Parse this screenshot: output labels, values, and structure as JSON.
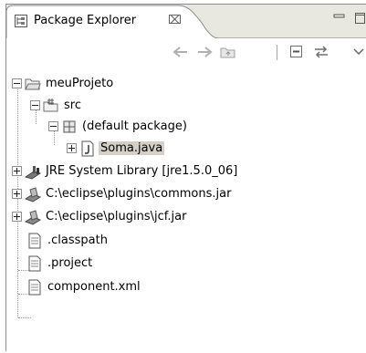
{
  "view": {
    "title": "Package Explorer",
    "close_glyph": "⌧",
    "icons": {
      "tab": "package-explorer-icon",
      "close": "close-icon",
      "minimize": "minimize-icon",
      "maximize": "maximize-icon"
    }
  },
  "toolbar": {
    "buttons": [
      {
        "name": "back-button",
        "icon": "arrow-left-icon"
      },
      {
        "name": "forward-button",
        "icon": "arrow-right-icon"
      },
      {
        "name": "up-button",
        "icon": "up-folder-icon"
      },
      {
        "name": "collapse-all-button",
        "icon": "collapse-all-icon"
      },
      {
        "name": "link-with-editor-button",
        "icon": "link-editor-icon"
      },
      {
        "name": "view-menu-button",
        "icon": "chevron-down-icon"
      }
    ]
  },
  "tree": {
    "project": {
      "label": "meuProjeto",
      "icon": "project-folder-icon",
      "expanded": true
    },
    "src": {
      "label": "src",
      "icon": "source-folder-icon",
      "expanded": true
    },
    "default_package": {
      "label": "(default package)",
      "icon": "package-icon",
      "expanded": true
    },
    "soma": {
      "label": "Soma.java",
      "icon": "java-file-icon",
      "expanded": false,
      "selected": true
    },
    "jre": {
      "label": "JRE System Library [jre1.5.0_06]",
      "icon": "library-icon",
      "expanded": false
    },
    "commons": {
      "label": "C:\\eclipse\\plugins\\commons.jar",
      "icon": "jar-icon",
      "expanded": false
    },
    "jcf": {
      "label": "C:\\eclipse\\plugins\\jcf.jar",
      "icon": "jar-icon",
      "expanded": false
    },
    "classpath": {
      "label": ".classpath",
      "icon": "file-icon"
    },
    "project_file": {
      "label": ".project",
      "icon": "file-icon"
    },
    "component": {
      "label": "component.xml",
      "icon": "file-icon"
    }
  },
  "colors": {
    "tab_bg": "#e9e8e0",
    "selection": "#d4d0c8",
    "border": "#8c8c8c"
  }
}
